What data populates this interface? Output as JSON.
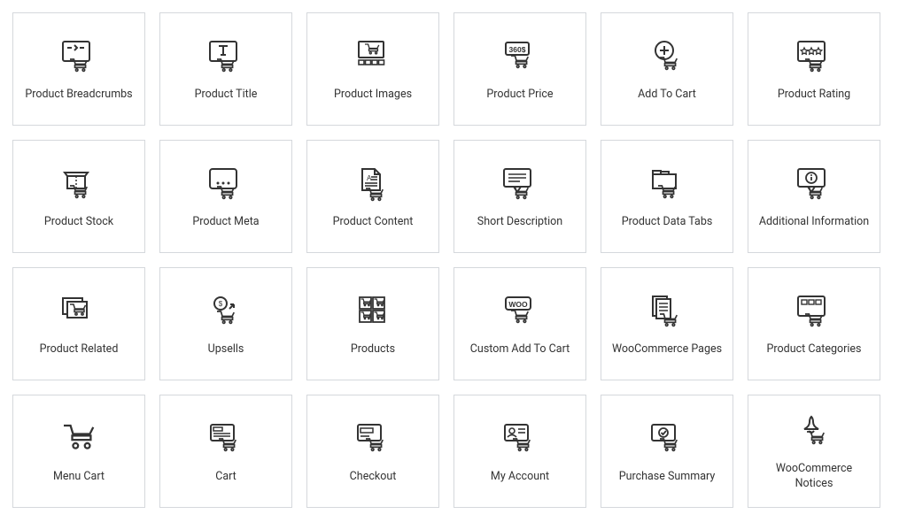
{
  "widgets": [
    {
      "label": "Product Breadcrumbs",
      "icon": "breadcrumbs"
    },
    {
      "label": "Product Title",
      "icon": "title"
    },
    {
      "label": "Product Images",
      "icon": "images"
    },
    {
      "label": "Product Price",
      "icon": "price"
    },
    {
      "label": "Add To Cart",
      "icon": "add-to-cart"
    },
    {
      "label": "Product Rating",
      "icon": "rating"
    },
    {
      "label": "Product Stock",
      "icon": "stock"
    },
    {
      "label": "Product Meta",
      "icon": "meta"
    },
    {
      "label": "Product Content",
      "icon": "content"
    },
    {
      "label": "Short Description",
      "icon": "short-desc"
    },
    {
      "label": "Product Data Tabs",
      "icon": "tabs"
    },
    {
      "label": "Additional Information",
      "icon": "info"
    },
    {
      "label": "Product Related",
      "icon": "related"
    },
    {
      "label": "Upsells",
      "icon": "upsells"
    },
    {
      "label": "Products",
      "icon": "products-grid"
    },
    {
      "label": "Custom Add To Cart",
      "icon": "custom-atc"
    },
    {
      "label": "WooCommerce Pages",
      "icon": "pages"
    },
    {
      "label": "Product Categories",
      "icon": "categories"
    },
    {
      "label": "Menu Cart",
      "icon": "menu-cart"
    },
    {
      "label": "Cart",
      "icon": "cart"
    },
    {
      "label": "Checkout",
      "icon": "checkout"
    },
    {
      "label": "My Account",
      "icon": "account"
    },
    {
      "label": "Purchase Summary",
      "icon": "summary"
    },
    {
      "label": "WooCommerce Notices",
      "icon": "notices"
    }
  ]
}
